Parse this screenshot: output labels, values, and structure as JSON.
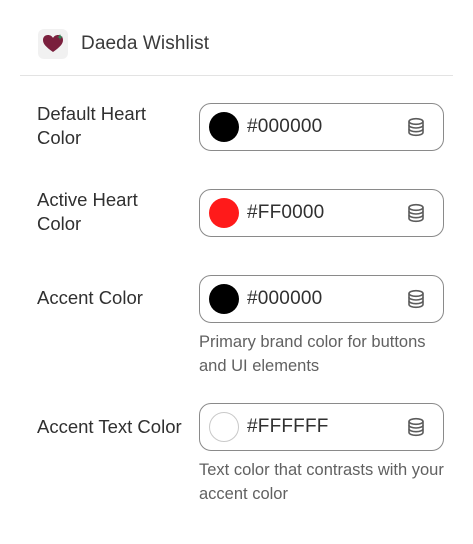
{
  "header": {
    "title": "Daeda Wishlist",
    "icon": "heart-app-icon"
  },
  "settings": [
    {
      "label": "Default Heart Color",
      "value": "#000000",
      "swatch_color": "#000000",
      "help": ""
    },
    {
      "label": "Active Heart Color",
      "value": "#FF0000",
      "swatch_color": "#FF0000",
      "help": ""
    },
    {
      "label": "Accent Color",
      "value": "#000000",
      "swatch_color": "#000000",
      "help": "Primary brand color for buttons and UI elements"
    },
    {
      "label": "Accent Text Color",
      "value": "#FFFFFF",
      "swatch_color": "#FFFFFF",
      "help": "Text color that contrasts with your accent color"
    }
  ],
  "icons": {
    "field_action": "database-icon"
  },
  "colors": {
    "heart": "#7a1f3d",
    "heart_sparkle": "#2e8b57",
    "field_border": "#8a8a8a",
    "help_text": "#616161"
  }
}
